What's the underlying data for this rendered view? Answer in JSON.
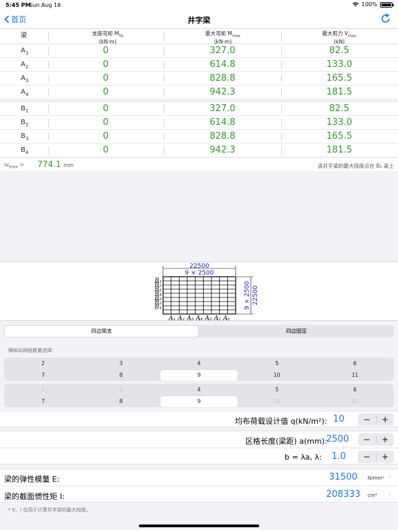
{
  "status": {
    "time": "5:45 PM",
    "date": "Sun Aug 16",
    "battery": "100%"
  },
  "nav": {
    "back": "首页",
    "title": "井字梁"
  },
  "table": {
    "headers": {
      "beam": "梁",
      "c1_line1": "支座弯矩 M",
      "c1_sub": "fix",
      "c1_line2": "(kN·m)",
      "c2_line1": "最大弯矩 M",
      "c2_sub": "max",
      "c2_line2": "(kN·m)",
      "c3_line1": "最大剪力 V",
      "c3_sub": "max",
      "c3_line2": "(kN)"
    },
    "groupA": [
      {
        "n": "A",
        "s": "1",
        "m": "0",
        "mmax": "327.0",
        "v": "82.5"
      },
      {
        "n": "A",
        "s": "2",
        "m": "0",
        "mmax": "614.8",
        "v": "133.0"
      },
      {
        "n": "A",
        "s": "3",
        "m": "0",
        "mmax": "828.8",
        "v": "165.5"
      },
      {
        "n": "A",
        "s": "4",
        "m": "0",
        "mmax": "942.3",
        "v": "181.5"
      }
    ],
    "groupB": [
      {
        "n": "B",
        "s": "1",
        "m": "0",
        "mmax": "327.0",
        "v": "82.5"
      },
      {
        "n": "B",
        "s": "2",
        "m": "0",
        "mmax": "614.8",
        "v": "133.0"
      },
      {
        "n": "B",
        "s": "3",
        "m": "0",
        "mmax": "828.8",
        "v": "165.5"
      },
      {
        "n": "B",
        "s": "4",
        "m": "0",
        "mmax": "942.3",
        "v": "181.5"
      }
    ],
    "w_label": "ω",
    "w_sub": "max",
    "w_eq": " =",
    "w_value": "774.1",
    "w_unit": "mm",
    "w_note": "该井字梁的最大挠度点在 B₄ 梁上"
  },
  "diagram": {
    "top_dim": "22500",
    "top_sub": "9 × 2500",
    "right_dim": "22500",
    "right_sub": "9 × 2500",
    "left_labels": [
      "B₁",
      "B₂",
      "B₃",
      "B₄",
      "B₃",
      "B₂",
      "B₁"
    ],
    "bottom_labels": [
      "A₁",
      "A₂",
      "A₃",
      "A₄",
      "A₃",
      "A₂",
      "A₁"
    ]
  },
  "support": {
    "options": [
      "四边简支",
      "四边固定"
    ],
    "selected": 0
  },
  "grid": {
    "label": "横纵向网格数量选择：",
    "set1": [
      [
        "2",
        "3",
        "4",
        "5",
        "6"
      ],
      [
        "7",
        "8",
        "9",
        "10",
        "11"
      ]
    ],
    "set1_selected": "9",
    "set2": [
      [
        "2",
        "3",
        "4",
        "5",
        "6"
      ],
      [
        "7",
        "8",
        "9",
        "10",
        "11"
      ]
    ],
    "set2_selected": "9",
    "set2_disabled": [
      "2",
      "3",
      "10",
      "11"
    ]
  },
  "load": {
    "label": "均布荷载设计值 q(kN/m²):",
    "value": "10"
  },
  "span": {
    "label": "区格长度(梁距) a(mm):",
    "value": "2500"
  },
  "ratio": {
    "label": "b = λa,   λ:",
    "value": "1.0"
  },
  "stepper": {
    "minus": "−",
    "plus": "+"
  },
  "modulus": {
    "label": "梁的弹性模量 E:",
    "value": "31500",
    "unit": "N/mm²"
  },
  "inertia": {
    "label": "梁的截面惯性矩 I:",
    "value": "208333",
    "unit": "cm⁴"
  },
  "footnote": "* E、I 仅用于计算井字梁的最大挠度。"
}
